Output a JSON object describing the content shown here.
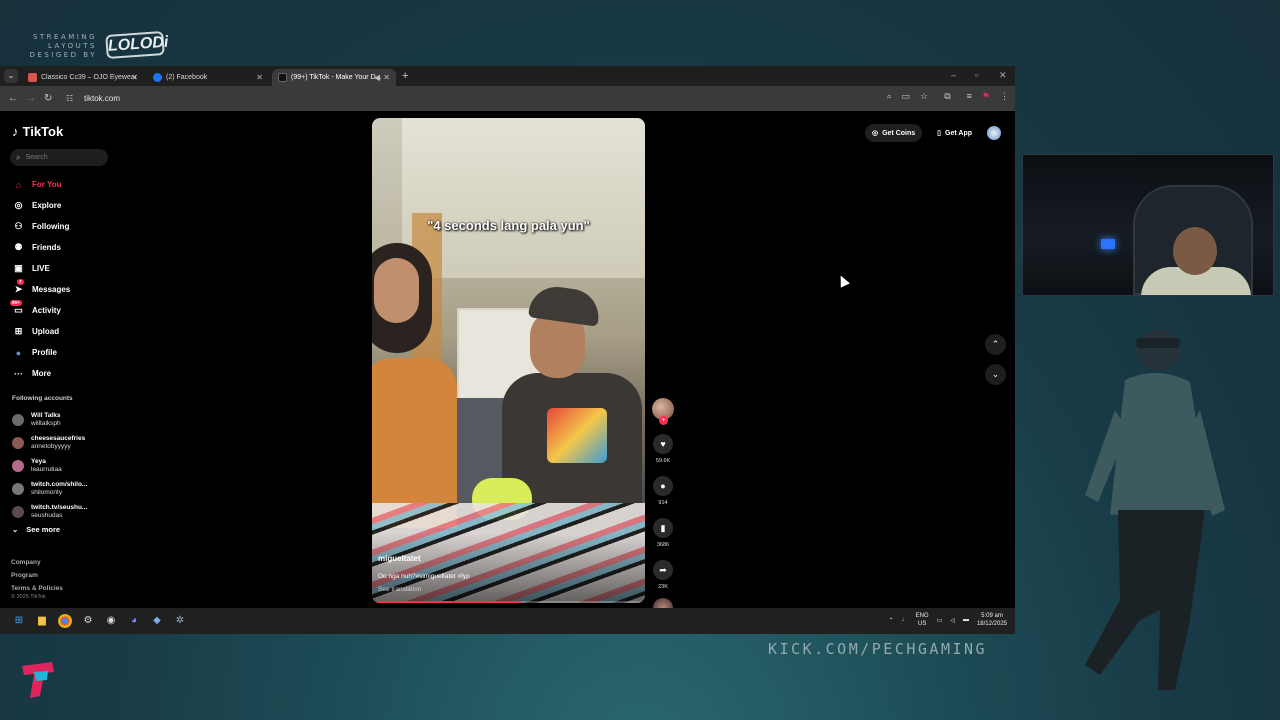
{
  "overlay": {
    "credit_text": "STREAMING LAYOUTS DESIGED BY",
    "logo_text": "LOLODi",
    "kick_url": "KICK.COM/PECHGAMING"
  },
  "browser": {
    "tabs": [
      {
        "label": "Classico Cc39 – OJO Eyewear",
        "favicon_color": "#d9534f",
        "active": false
      },
      {
        "label": "(2) Facebook",
        "favicon_color": "#1877f2",
        "active": false
      },
      {
        "label": "(99+) TikTok - Make Your D...",
        "favicon_color": "#111111",
        "active": true
      }
    ],
    "new_tab_icon": "plus-icon",
    "url": "tiktok.com"
  },
  "tiktok": {
    "logo": "TikTok",
    "search_placeholder": "Search",
    "nav": [
      {
        "label": "For You",
        "icon": "home-icon",
        "glyph": "⌂",
        "active": true
      },
      {
        "label": "Explore",
        "icon": "compass-icon",
        "glyph": "◎",
        "active": false
      },
      {
        "label": "Following",
        "icon": "person-follow-icon",
        "glyph": "⚇",
        "active": false
      },
      {
        "label": "Friends",
        "icon": "friends-icon",
        "glyph": "⚉",
        "active": false
      },
      {
        "label": "LIVE",
        "icon": "live-icon",
        "glyph": "▣",
        "active": false
      },
      {
        "label": "Messages",
        "icon": "send-icon",
        "glyph": "➤",
        "active": false,
        "badge": "7"
      },
      {
        "label": "Activity",
        "icon": "activity-icon",
        "glyph": "▭",
        "active": false,
        "badge": "99+"
      },
      {
        "label": "Upload",
        "icon": "upload-icon",
        "glyph": "⊞",
        "active": false
      },
      {
        "label": "Profile",
        "icon": "profile-icon",
        "glyph": "●",
        "active": false
      },
      {
        "label": "More",
        "icon": "more-icon",
        "glyph": "···",
        "active": false
      }
    ],
    "following_heading": "Following accounts",
    "accounts": [
      {
        "name": "Will Talks",
        "handle": "willtalksph"
      },
      {
        "name": "cheesesaucefries",
        "handle": "annetobyyyyy"
      },
      {
        "name": "Yeya",
        "handle": "leaurrutiaa"
      },
      {
        "name": "twitch.com/shilo...",
        "handle": "shilomonty"
      },
      {
        "name": "twitch.tv/seushu...",
        "handle": "seushudas"
      }
    ],
    "see_more": "See more",
    "footer_links": [
      "Company",
      "Program",
      "Terms & Policies"
    ],
    "copyright": "© 2025 TikTok",
    "top_right": {
      "get_coins": "Get Coins",
      "get_app": "Get App"
    },
    "video": {
      "caption_overlay": "\"4 seconds lang pala yun\"",
      "author": "migueltatet",
      "description": "Oo nga nuh?#simigueltatet #fyp",
      "see_translation": "See translation",
      "progress": 0.55
    },
    "actions": {
      "likes": "59.6K",
      "comments": "914",
      "saves": "3686",
      "shares": "23K"
    }
  },
  "taskbar": {
    "lang_top": "ENG",
    "lang_bottom": "US",
    "time": "5:09 am",
    "date": "18/12/2025"
  }
}
